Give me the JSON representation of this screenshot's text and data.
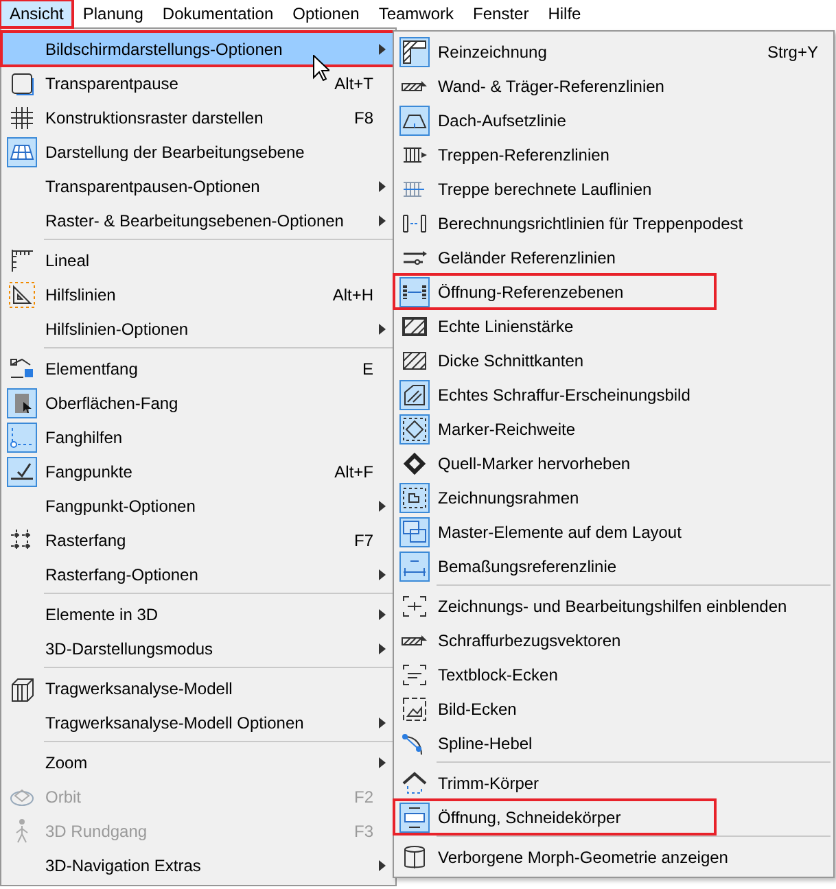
{
  "menubar": [
    {
      "label": "Ansicht",
      "selected": true,
      "marked": true
    },
    {
      "label": "Planung",
      "selected": false,
      "marked": false
    },
    {
      "label": "Dokumentation",
      "selected": false,
      "marked": false
    },
    {
      "label": "Optionen",
      "selected": false,
      "marked": false
    },
    {
      "label": "Teamwork",
      "selected": false,
      "marked": false
    },
    {
      "label": "Fenster",
      "selected": false,
      "marked": false
    },
    {
      "label": "Hilfe",
      "selected": false,
      "marked": false
    }
  ],
  "menu": {
    "items": [
      {
        "kind": "item",
        "label": "Bildschirmdarstellungs-Optionen",
        "submenu": true,
        "selected": true,
        "marked": true,
        "disabled": false
      },
      {
        "kind": "item",
        "label": "Transparentpause",
        "shortcut": "Alt+T",
        "submenu": false,
        "selected": false,
        "marked": false,
        "disabled": false,
        "checked": false
      },
      {
        "kind": "item",
        "label": "Konstruktionsraster darstellen",
        "shortcut": "F8",
        "submenu": false,
        "selected": false,
        "marked": false,
        "disabled": false,
        "checked": false
      },
      {
        "kind": "item",
        "label": "Darstellung der Bearbeitungsebene",
        "submenu": false,
        "selected": false,
        "marked": false,
        "disabled": false,
        "checked": true
      },
      {
        "kind": "item",
        "label": "Transparentpausen-Optionen",
        "submenu": true,
        "selected": false,
        "marked": false,
        "disabled": false
      },
      {
        "kind": "item",
        "label": "Raster- & Bearbeitungsebenen-Optionen",
        "submenu": true,
        "selected": false,
        "marked": false,
        "disabled": false
      },
      {
        "kind": "separator"
      },
      {
        "kind": "item",
        "label": "Lineal",
        "submenu": false,
        "selected": false,
        "marked": false,
        "disabled": false,
        "checked": false
      },
      {
        "kind": "item",
        "label": "Hilfslinien",
        "shortcut": "Alt+H",
        "submenu": false,
        "selected": false,
        "marked": false,
        "disabled": false,
        "checked": false
      },
      {
        "kind": "item",
        "label": "Hilfslinien-Optionen",
        "submenu": true,
        "selected": false,
        "marked": false,
        "disabled": false
      },
      {
        "kind": "separator"
      },
      {
        "kind": "item",
        "label": "Elementfang",
        "shortcut": "E",
        "submenu": false,
        "selected": false,
        "marked": false,
        "disabled": false,
        "checked": false
      },
      {
        "kind": "item",
        "label": "Oberflächen-Fang",
        "submenu": false,
        "selected": false,
        "marked": false,
        "disabled": false,
        "checked": true
      },
      {
        "kind": "item",
        "label": "Fanghilfen",
        "submenu": false,
        "selected": false,
        "marked": false,
        "disabled": false,
        "checked": true
      },
      {
        "kind": "item",
        "label": "Fangpunkte",
        "shortcut": "Alt+F",
        "submenu": false,
        "selected": false,
        "marked": false,
        "disabled": false,
        "checked": true
      },
      {
        "kind": "item",
        "label": "Fangpunkt-Optionen",
        "submenu": true,
        "selected": false,
        "marked": false,
        "disabled": false
      },
      {
        "kind": "item",
        "label": "Rasterfang",
        "shortcut": "F7",
        "submenu": false,
        "selected": false,
        "marked": false,
        "disabled": false,
        "checked": false
      },
      {
        "kind": "item",
        "label": "Rasterfang-Optionen",
        "submenu": true,
        "selected": false,
        "marked": false,
        "disabled": false
      },
      {
        "kind": "separator"
      },
      {
        "kind": "item",
        "label": "Elemente in 3D",
        "submenu": true,
        "selected": false,
        "marked": false,
        "disabled": false
      },
      {
        "kind": "item",
        "label": "3D-Darstellungsmodus",
        "submenu": true,
        "selected": false,
        "marked": false,
        "disabled": false
      },
      {
        "kind": "separator"
      },
      {
        "kind": "item",
        "label": "Tragwerksanalyse-Modell",
        "submenu": false,
        "selected": false,
        "marked": false,
        "disabled": false,
        "checked": false
      },
      {
        "kind": "item",
        "label": "Tragwerksanalyse-Modell Optionen",
        "submenu": true,
        "selected": false,
        "marked": false,
        "disabled": false
      },
      {
        "kind": "separator"
      },
      {
        "kind": "item",
        "label": "Zoom",
        "submenu": true,
        "selected": false,
        "marked": false,
        "disabled": false
      },
      {
        "kind": "item",
        "label": "Orbit",
        "shortcut": "F2",
        "submenu": false,
        "selected": false,
        "marked": false,
        "disabled": true,
        "checked": false
      },
      {
        "kind": "item",
        "label": "3D Rundgang",
        "shortcut": "F3",
        "submenu": false,
        "selected": false,
        "marked": false,
        "disabled": true,
        "checked": false
      },
      {
        "kind": "item",
        "label": "3D-Navigation Extras",
        "submenu": true,
        "selected": false,
        "marked": false,
        "disabled": false
      }
    ]
  },
  "submenu": {
    "items": [
      {
        "kind": "item",
        "label": "Reinzeichnung",
        "shortcut": "Strg+Y",
        "marked": false,
        "checked": true
      },
      {
        "kind": "item",
        "label": "Wand- & Träger-Referenzlinien",
        "marked": false,
        "checked": false
      },
      {
        "kind": "item",
        "label": "Dach-Aufsetzlinie",
        "marked": false,
        "checked": true
      },
      {
        "kind": "item",
        "label": "Treppen-Referenzlinien",
        "marked": false,
        "checked": false
      },
      {
        "kind": "item",
        "label": "Treppe berechnete Lauflinien",
        "marked": false,
        "checked": false
      },
      {
        "kind": "item",
        "label": "Berechnungsrichtlinien für Treppenpodest",
        "marked": false,
        "checked": false
      },
      {
        "kind": "item",
        "label": "Geländer Referenzlinien",
        "marked": false,
        "checked": false
      },
      {
        "kind": "item",
        "label": "Öffnung-Referenzebenen",
        "marked": true,
        "checked": true
      },
      {
        "kind": "item",
        "label": "Echte Linienstärke",
        "marked": false,
        "checked": false
      },
      {
        "kind": "item",
        "label": "Dicke Schnittkanten",
        "marked": false,
        "checked": false
      },
      {
        "kind": "item",
        "label": "Echtes Schraffur-Erscheinungsbild",
        "marked": false,
        "checked": true
      },
      {
        "kind": "item",
        "label": "Marker-Reichweite",
        "marked": false,
        "checked": true
      },
      {
        "kind": "item",
        "label": "Quell-Marker hervorheben",
        "marked": false,
        "checked": false
      },
      {
        "kind": "item",
        "label": "Zeichnungsrahmen",
        "marked": false,
        "checked": true
      },
      {
        "kind": "item",
        "label": "Master-Elemente auf dem Layout",
        "marked": false,
        "checked": true
      },
      {
        "kind": "item",
        "label": "Bemaßungsreferenzlinie",
        "marked": false,
        "checked": true
      },
      {
        "kind": "separator"
      },
      {
        "kind": "item",
        "label": "Zeichnungs- und Bearbeitungshilfen einblenden",
        "marked": false,
        "checked": false
      },
      {
        "kind": "item",
        "label": "Schraffurbezugsvektoren",
        "marked": false,
        "checked": false
      },
      {
        "kind": "item",
        "label": "Textblock-Ecken",
        "marked": false,
        "checked": false
      },
      {
        "kind": "item",
        "label": "Bild-Ecken",
        "marked": false,
        "checked": false
      },
      {
        "kind": "item",
        "label": "Spline-Hebel",
        "marked": false,
        "checked": false
      },
      {
        "kind": "separator"
      },
      {
        "kind": "item",
        "label": "Trimm-Körper",
        "marked": false,
        "checked": false
      },
      {
        "kind": "item",
        "label": "Öffnung, Schneidekörper",
        "marked": true,
        "checked": true
      },
      {
        "kind": "separator"
      },
      {
        "kind": "item",
        "label": "Verborgene Morph-Geometrie anzeigen",
        "marked": false,
        "checked": false
      }
    ]
  }
}
